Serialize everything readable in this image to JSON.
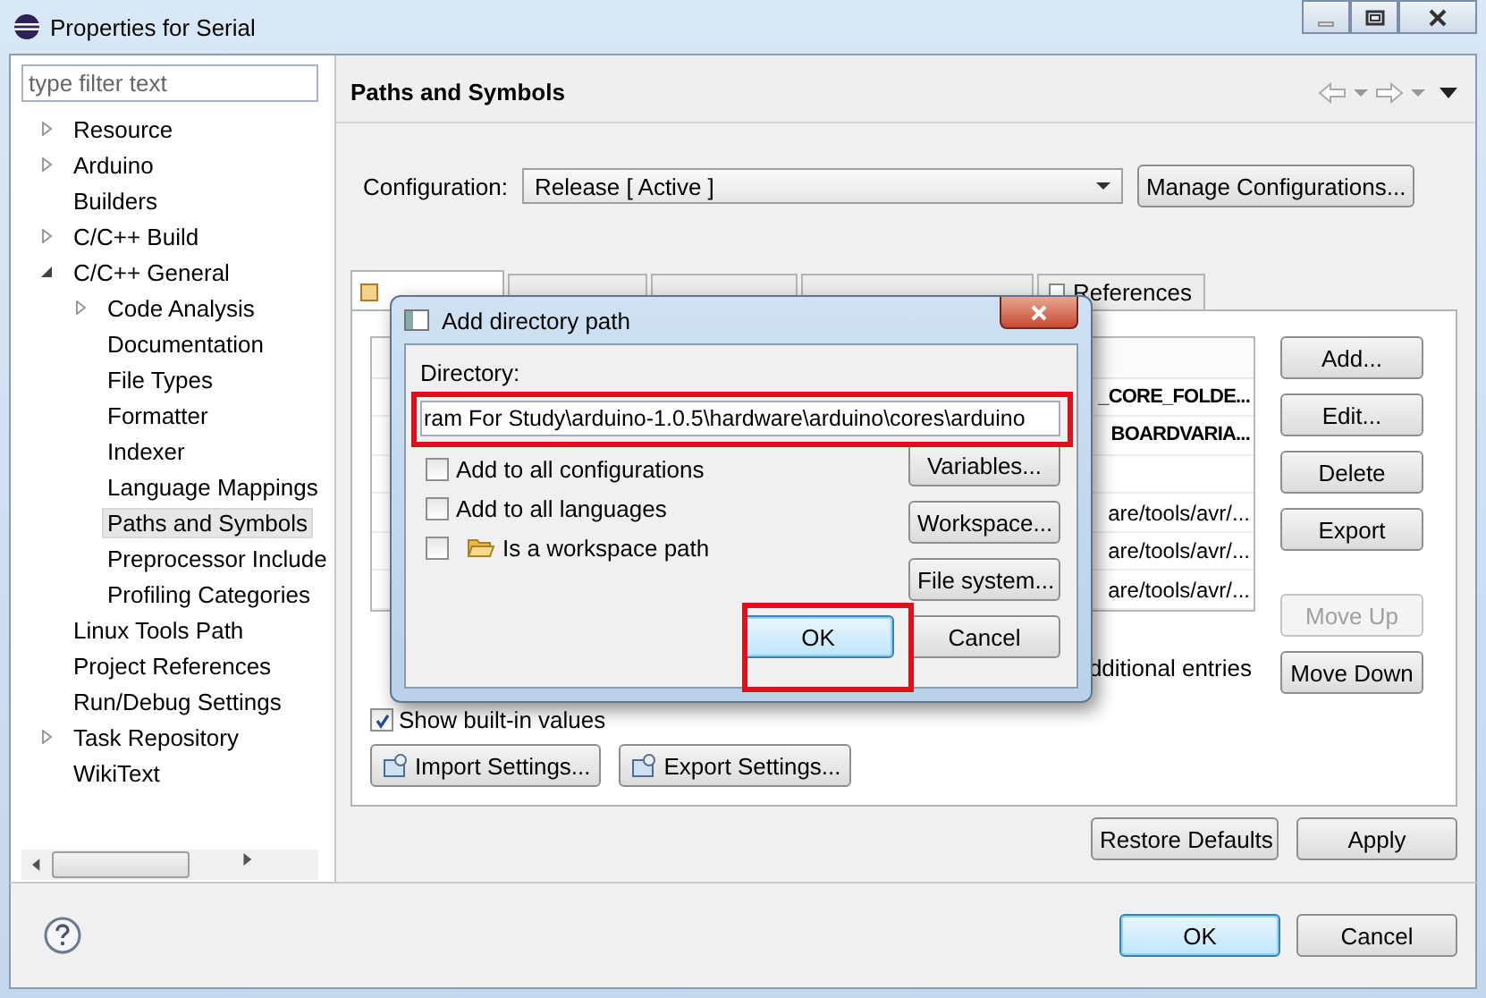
{
  "window": {
    "title": "Properties for Serial"
  },
  "sidebar": {
    "filter": {
      "placeholder": "type filter text"
    },
    "tree": [
      {
        "label": "Resource",
        "expanded": false,
        "selected": false
      },
      {
        "label": "Arduino",
        "expanded": false,
        "selected": false
      },
      {
        "label": "Builders",
        "selected": false
      },
      {
        "label": "C/C++ Build",
        "expanded": false,
        "selected": false
      },
      {
        "label": "C/C++ General",
        "expanded": true,
        "selected": false,
        "children": [
          {
            "label": "Code Analysis",
            "expanded": false,
            "selected": false
          },
          {
            "label": "Documentation",
            "selected": false
          },
          {
            "label": "File Types",
            "selected": false
          },
          {
            "label": "Formatter",
            "selected": false
          },
          {
            "label": "Indexer",
            "selected": false
          },
          {
            "label": "Language Mappings",
            "selected": false
          },
          {
            "label": "Paths and Symbols",
            "selected": true
          },
          {
            "label": "Preprocessor Include",
            "selected": false
          },
          {
            "label": "Profiling Categories",
            "selected": false
          }
        ]
      },
      {
        "label": "Linux Tools Path",
        "selected": false
      },
      {
        "label": "Project References",
        "selected": false
      },
      {
        "label": "Run/Debug Settings",
        "selected": false
      },
      {
        "label": "Task Repository",
        "expanded": false,
        "selected": false
      },
      {
        "label": "WikiText",
        "selected": false
      }
    ]
  },
  "page": {
    "title": "Paths and Symbols",
    "configuration": {
      "label": "Configuration:",
      "value": "Release  [ Active ]",
      "manage_button": "Manage Configurations..."
    },
    "tabs": [
      {
        "selected": true
      },
      {
        "selected": false
      },
      {
        "selected": false
      },
      {
        "selected": false
      },
      {
        "label": "References",
        "selected": false
      }
    ],
    "table": {
      "rows": [
        {
          "kind": "entry",
          "text": "_CORE_FOLDE...",
          "bold": true
        },
        {
          "kind": "entry",
          "text": "BOARDVARIA...",
          "bold": true
        },
        {
          "kind": "gap"
        },
        {
          "kind": "entry",
          "text": "are/tools/avr/...",
          "bold": false
        },
        {
          "kind": "entry",
          "text": "are/tools/avr/...",
          "bold": false
        },
        {
          "kind": "entry",
          "text": "are/tools/avr/...",
          "bold": false
        }
      ]
    },
    "note": "dditional entries",
    "side_buttons": [
      {
        "label": "Add...",
        "disabled": false
      },
      {
        "label": "Edit...",
        "disabled": false
      },
      {
        "label": "Delete",
        "disabled": false
      },
      {
        "label": "Export",
        "disabled": false
      },
      {
        "label": "Move Up",
        "disabled": true
      },
      {
        "label": "Move Down",
        "disabled": false
      }
    ],
    "show_builtin": {
      "label": "Show built-in values",
      "checked": true
    },
    "settings_buttons": [
      "Import Settings...",
      "Export Settings..."
    ],
    "bottom_buttons": [
      "Restore Defaults",
      "Apply"
    ]
  },
  "dialog": {
    "title": "Add directory path",
    "directory_label": "Directory:",
    "directory_value": "ram For Study\\arduino-1.0.5\\hardware\\arduino\\cores\\arduino",
    "options": [
      {
        "kind": "plain",
        "label": "Add to all configurations",
        "checked": false
      },
      {
        "kind": "plain",
        "label": "Add to all languages",
        "checked": false
      },
      {
        "kind": "folder",
        "label": "Is a workspace path",
        "checked": false
      }
    ],
    "side_buttons": [
      "Variables...",
      "Workspace...",
      "File system..."
    ],
    "buttons": [
      {
        "label": "OK",
        "default": true
      },
      {
        "label": "Cancel",
        "default": false
      }
    ]
  },
  "footer": {
    "buttons": [
      {
        "label": "OK",
        "default": true
      },
      {
        "label": "Cancel",
        "default": false
      }
    ]
  }
}
